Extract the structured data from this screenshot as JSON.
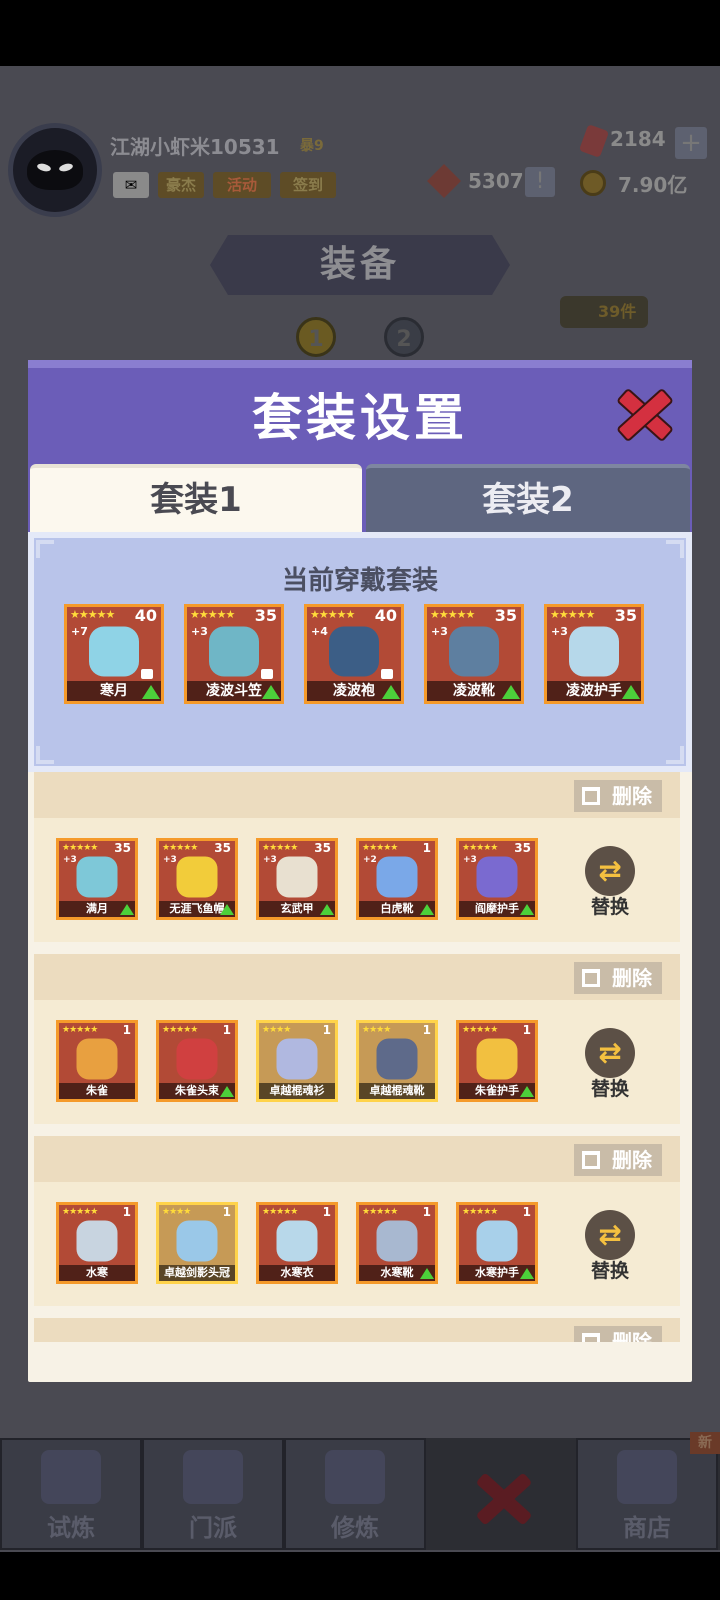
{
  "hud": {
    "player_name": "江湖小虾米10531",
    "vip": "暴9",
    "mail_label": "",
    "btn_hero": "豪杰",
    "btn_activity": "活动",
    "btn_signin": "签到",
    "gems": "2184",
    "tokens": "5307",
    "gold": "7.90亿"
  },
  "page": {
    "title": "装备",
    "item_count": "39件",
    "set_pages": [
      "1",
      "2"
    ]
  },
  "modal": {
    "title": "套装设置",
    "tabs": [
      {
        "label": "套装1",
        "active": true
      },
      {
        "label": "套装2",
        "active": false
      }
    ],
    "current_title": "当前穿戴套装",
    "current_items": [
      {
        "name": "寒月",
        "level": "40",
        "enhance": "+7",
        "stars": "★★★★★",
        "locked": true,
        "upgrade": true,
        "color": "#8fd3e6"
      },
      {
        "name": "凌波斗笠",
        "level": "35",
        "enhance": "+3",
        "stars": "★★★★★",
        "locked": true,
        "upgrade": true,
        "color": "#6fb6c6"
      },
      {
        "name": "凌波袍",
        "level": "40",
        "enhance": "+4",
        "stars": "★★★★★",
        "locked": true,
        "upgrade": true,
        "color": "#3c5e86"
      },
      {
        "name": "凌波靴",
        "level": "35",
        "enhance": "+3",
        "stars": "★★★★★",
        "locked": false,
        "upgrade": true,
        "color": "#5e7fa0"
      },
      {
        "name": "凌波护手",
        "level": "35",
        "enhance": "+3",
        "stars": "★★★★★",
        "locked": false,
        "upgrade": true,
        "color": "#b6d8ea"
      }
    ],
    "delete_label": "删除",
    "swap_label": "替换",
    "saved_sets": [
      {
        "items": [
          {
            "name": "满月",
            "level": "35",
            "enhance": "+3",
            "stars": "★★★★★",
            "upgrade": true,
            "gold": false,
            "color": "#7ec8d8"
          },
          {
            "name": "无涯飞鱼帽",
            "level": "35",
            "enhance": "+3",
            "stars": "★★★★★",
            "upgrade": true,
            "gold": false,
            "color": "#f2cc3a"
          },
          {
            "name": "玄武甲",
            "level": "35",
            "enhance": "+3",
            "stars": "★★★★★",
            "upgrade": true,
            "gold": false,
            "color": "#e8e0d0"
          },
          {
            "name": "白虎靴",
            "level": "1",
            "enhance": "+2",
            "stars": "★★★★★",
            "upgrade": true,
            "gold": false,
            "color": "#7aa8e8"
          },
          {
            "name": "阎摩护手",
            "level": "35",
            "enhance": "+3",
            "stars": "★★★★★",
            "upgrade": true,
            "gold": false,
            "color": "#7a6ad0"
          }
        ]
      },
      {
        "items": [
          {
            "name": "朱雀",
            "level": "1",
            "enhance": "",
            "stars": "★★★★★",
            "upgrade": false,
            "gold": false,
            "color": "#e8a040"
          },
          {
            "name": "朱雀头束",
            "level": "1",
            "enhance": "",
            "stars": "★★★★★",
            "upgrade": true,
            "gold": false,
            "color": "#d04040"
          },
          {
            "name": "卓越棍魂衫",
            "level": "1",
            "enhance": "",
            "stars": "★★★★",
            "upgrade": false,
            "gold": true,
            "color": "#b0b8e0"
          },
          {
            "name": "卓越棍魂靴",
            "level": "1",
            "enhance": "",
            "stars": "★★★★",
            "upgrade": false,
            "gold": true,
            "color": "#5e6a8a"
          },
          {
            "name": "朱雀护手",
            "level": "1",
            "enhance": "",
            "stars": "★★★★★",
            "upgrade": true,
            "gold": false,
            "color": "#f2c040"
          }
        ]
      },
      {
        "items": [
          {
            "name": "水寒",
            "level": "1",
            "enhance": "",
            "stars": "★★★★★",
            "upgrade": false,
            "gold": false,
            "color": "#c8d4e0"
          },
          {
            "name": "卓越剑影头冠",
            "level": "1",
            "enhance": "",
            "stars": "★★★★",
            "upgrade": false,
            "gold": true,
            "color": "#9ac8e8"
          },
          {
            "name": "水寒衣",
            "level": "1",
            "enhance": "",
            "stars": "★★★★★",
            "upgrade": false,
            "gold": false,
            "color": "#b8d8ea"
          },
          {
            "name": "水寒靴",
            "level": "1",
            "enhance": "",
            "stars": "★★★★★",
            "upgrade": true,
            "gold": false,
            "color": "#a8b8d0"
          },
          {
            "name": "水寒护手",
            "level": "1",
            "enhance": "",
            "stars": "★★★★★",
            "upgrade": true,
            "gold": false,
            "color": "#a8d0ea"
          }
        ]
      },
      {
        "items": []
      }
    ]
  },
  "nav": {
    "items": [
      "试炼",
      "门派",
      "修炼",
      "",
      "商店"
    ],
    "new_badge": "新"
  }
}
